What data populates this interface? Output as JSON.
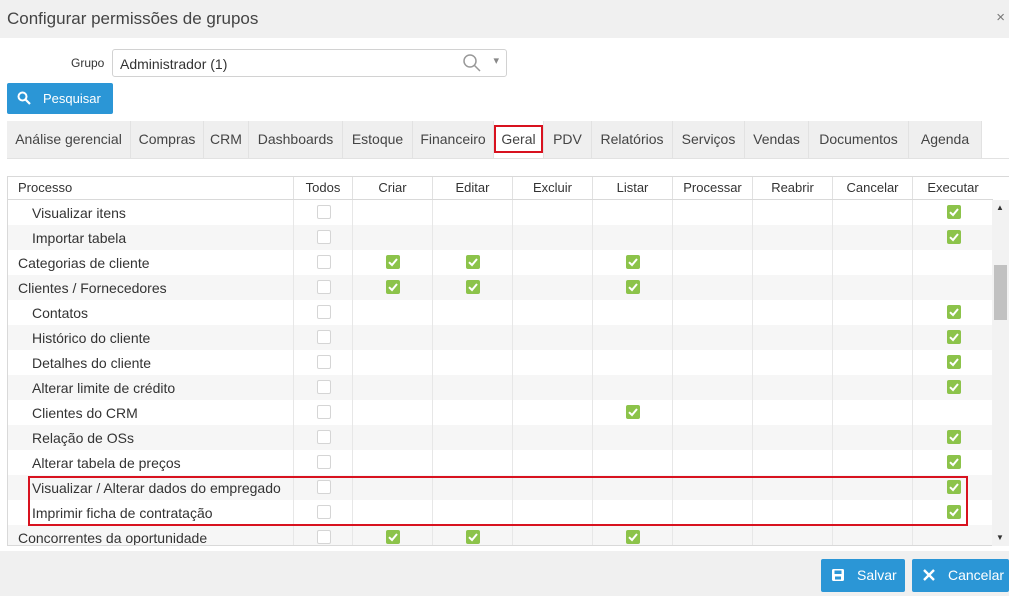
{
  "dialog": {
    "title": "Configurar permissões de grupos"
  },
  "grupo": {
    "label": "Grupo",
    "value": "Administrador (1)"
  },
  "search_button": {
    "label": "Pesquisar"
  },
  "tabs": [
    {
      "label": "Análise gerencial"
    },
    {
      "label": "Compras"
    },
    {
      "label": "CRM"
    },
    {
      "label": "Dashboards"
    },
    {
      "label": "Estoque"
    },
    {
      "label": "Financeiro"
    },
    {
      "label": "Geral",
      "active": true
    },
    {
      "label": "PDV"
    },
    {
      "label": "Relatórios"
    },
    {
      "label": "Serviços"
    },
    {
      "label": "Vendas"
    },
    {
      "label": "Documentos"
    },
    {
      "label": "Agenda"
    }
  ],
  "table": {
    "columns": [
      "Processo",
      "Todos",
      "Criar",
      "Editar",
      "Excluir",
      "Listar",
      "Processar",
      "Reabrir",
      "Cancelar",
      "Executar"
    ],
    "rows": [
      {
        "name": "Visualizar itens",
        "indent": true,
        "checked": [
          false,
          false,
          false,
          false,
          false,
          false,
          false,
          false,
          true
        ]
      },
      {
        "name": "Importar tabela",
        "indent": true,
        "checked": [
          false,
          false,
          false,
          false,
          false,
          false,
          false,
          false,
          true
        ]
      },
      {
        "name": "Categorias de cliente",
        "indent": false,
        "checked": [
          false,
          true,
          true,
          false,
          true,
          false,
          false,
          false,
          false
        ]
      },
      {
        "name": "Clientes / Fornecedores",
        "indent": false,
        "checked": [
          false,
          true,
          true,
          false,
          true,
          false,
          false,
          false,
          false
        ]
      },
      {
        "name": "Contatos",
        "indent": true,
        "checked": [
          false,
          false,
          false,
          false,
          false,
          false,
          false,
          false,
          true
        ]
      },
      {
        "name": "Histórico do cliente",
        "indent": true,
        "checked": [
          false,
          false,
          false,
          false,
          false,
          false,
          false,
          false,
          true
        ]
      },
      {
        "name": "Detalhes do cliente",
        "indent": true,
        "checked": [
          false,
          false,
          false,
          false,
          false,
          false,
          false,
          false,
          true
        ]
      },
      {
        "name": "Alterar limite de crédito",
        "indent": true,
        "checked": [
          false,
          false,
          false,
          false,
          false,
          false,
          false,
          false,
          true
        ]
      },
      {
        "name": "Clientes do CRM",
        "indent": true,
        "checked": [
          false,
          false,
          false,
          false,
          true,
          false,
          false,
          false,
          false
        ]
      },
      {
        "name": "Relação de OSs",
        "indent": true,
        "checked": [
          false,
          false,
          false,
          false,
          false,
          false,
          false,
          false,
          true
        ]
      },
      {
        "name": "Alterar tabela de preços",
        "indent": true,
        "checked": [
          false,
          false,
          false,
          false,
          false,
          false,
          false,
          false,
          true
        ]
      },
      {
        "name": "Visualizar / Alterar dados do empregado",
        "indent": true,
        "checked": [
          false,
          false,
          false,
          false,
          false,
          false,
          false,
          false,
          true
        ]
      },
      {
        "name": "Imprimir ficha de contratação",
        "indent": true,
        "checked": [
          false,
          false,
          false,
          false,
          false,
          false,
          false,
          false,
          true
        ]
      },
      {
        "name": "Concorrentes da oportunidade",
        "indent": false,
        "checked": [
          false,
          true,
          true,
          false,
          true,
          false,
          false,
          false,
          false
        ]
      }
    ]
  },
  "footer": {
    "save_label": "Salvar",
    "cancel_label": "Cancelar"
  },
  "colors": {
    "accent": "#2b96d6",
    "checked": "#8cc34a",
    "highlight": "#d8121f"
  }
}
